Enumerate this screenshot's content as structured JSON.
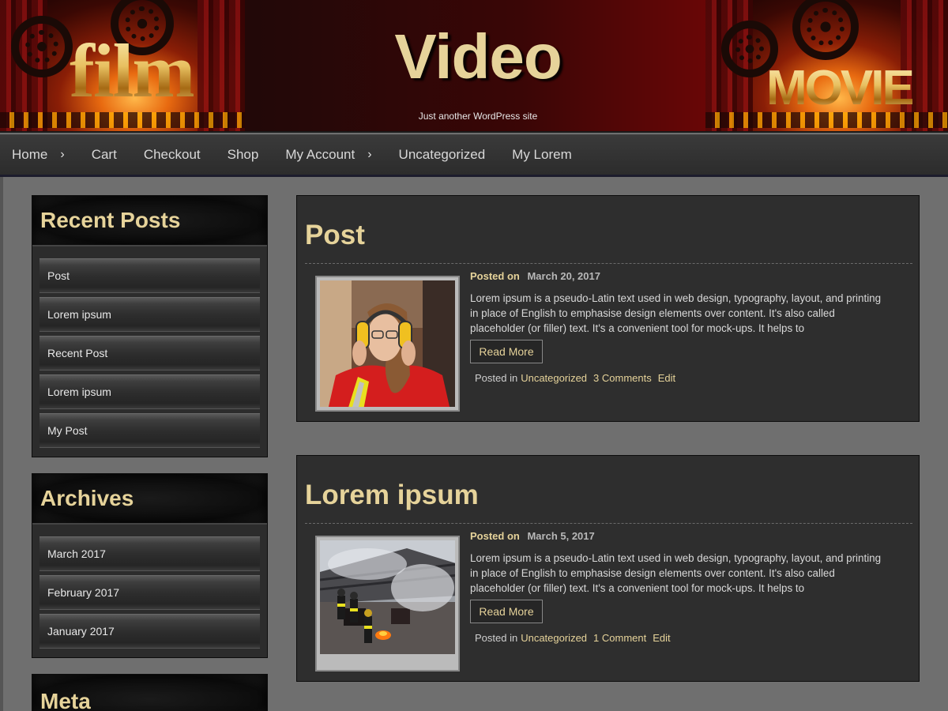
{
  "header": {
    "site_title": "Video",
    "tagline": "Just another WordPress site",
    "banner_left_word": "film",
    "banner_right_word": "MOVIE"
  },
  "nav": {
    "items": [
      {
        "label": "Home",
        "has_submenu": true
      },
      {
        "label": "Cart",
        "has_submenu": false
      },
      {
        "label": "Checkout",
        "has_submenu": false
      },
      {
        "label": "Shop",
        "has_submenu": false
      },
      {
        "label": "My Account",
        "has_submenu": true
      },
      {
        "label": "Uncategorized",
        "has_submenu": false
      },
      {
        "label": "My Lorem",
        "has_submenu": false
      }
    ],
    "submenu_glyph": "›"
  },
  "sidebar": {
    "recent_posts": {
      "title": "Recent Posts",
      "items": [
        "Post",
        "Lorem ipsum",
        "Recent Post",
        "Lorem ipsum",
        "My Post"
      ]
    },
    "archives": {
      "title": "Archives",
      "items": [
        "March 2017",
        "February 2017",
        "January 2017"
      ]
    },
    "meta": {
      "title": "Meta"
    }
  },
  "posts": [
    {
      "title": "Post",
      "posted_on_label": "Posted on",
      "date": "March 20, 2017",
      "excerpt": "Lorem ipsum is a pseudo-Latin text used in web design, typography, layout, and printing in place of English to emphasise design elements over content. It's also called placeholder (or filler) text. It's a convenient tool for mock-ups. It helps to",
      "read_more": "Read More",
      "posted_in_label": "Posted in",
      "category": "Uncategorized",
      "comments": "3 Comments",
      "edit": "Edit",
      "thumbnail": "woman-with-ear-protectors-image"
    },
    {
      "title": "Lorem ipsum",
      "posted_on_label": "Posted on",
      "date": "March 5, 2017",
      "excerpt": "Lorem ipsum is a pseudo-Latin text used in web design, typography, layout, and printing in place of English to emphasise design elements over content. It's also called placeholder (or filler) text. It's a convenient tool for mock-ups. It helps to",
      "read_more": "Read More",
      "posted_in_label": "Posted in",
      "category": "Uncategorized",
      "comments": "1 Comment",
      "edit": "Edit",
      "thumbnail": "firefighters-burning-house-image"
    }
  ],
  "colors": {
    "accent_gold": "#e6d39a",
    "page_bg": "#6f6f6f",
    "panel_bg": "#2e2e2e"
  }
}
